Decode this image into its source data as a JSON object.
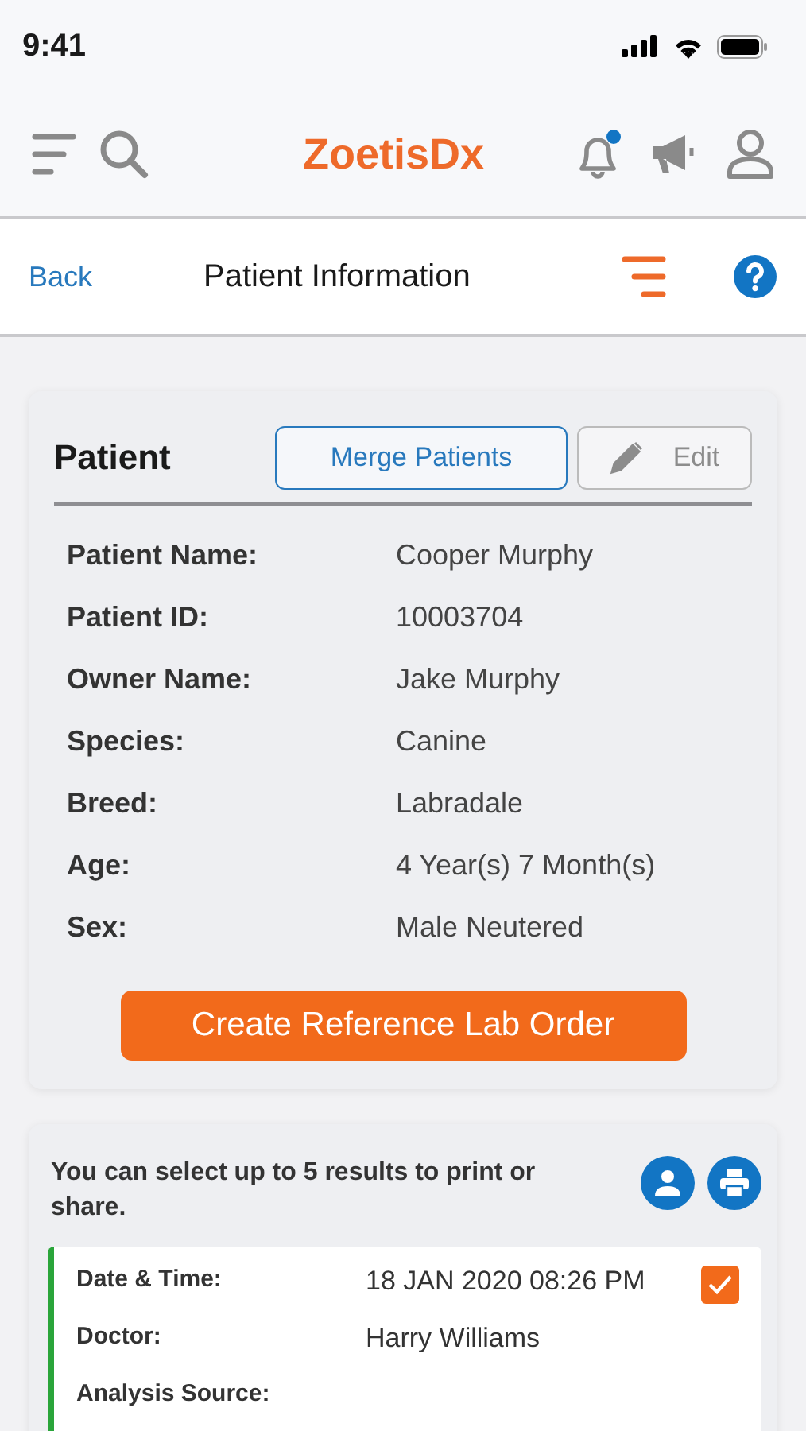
{
  "status_bar": {
    "time": "9:41"
  },
  "app_bar": {
    "brand": "ZoetisDx",
    "notification_unread": true
  },
  "nav_bar": {
    "back": "Back",
    "title": "Patient Information"
  },
  "patient_card": {
    "title": "Patient",
    "merge_button": "Merge Patients",
    "edit_button": {
      "label": "Edit",
      "disabled": true
    },
    "fields": [
      {
        "label": "Patient Name:",
        "value": "Cooper Murphy"
      },
      {
        "label": "Patient ID:",
        "value": "10003704"
      },
      {
        "label": "Owner Name:",
        "value": "Jake Murphy"
      },
      {
        "label": "Species:",
        "value": "Canine"
      },
      {
        "label": "Breed:",
        "value": "Labradale"
      },
      {
        "label": "Age:",
        "value": "4 Year(s) 7 Month(s)"
      },
      {
        "label": "Sex:",
        "value": "Male Neutered"
      }
    ],
    "order_button": "Create Reference Lab Order"
  },
  "results": {
    "instructions": "You can select up to 5 results to print or share.",
    "items": [
      {
        "color": "#2aa53a",
        "selected": true,
        "fields": [
          {
            "label": "Date & Time:",
            "value": "18 JAN 2020 08:26 PM"
          },
          {
            "label": "Doctor:",
            "value": "Harry Williams"
          },
          {
            "label": "Analysis Source:"
          }
        ]
      }
    ]
  }
}
